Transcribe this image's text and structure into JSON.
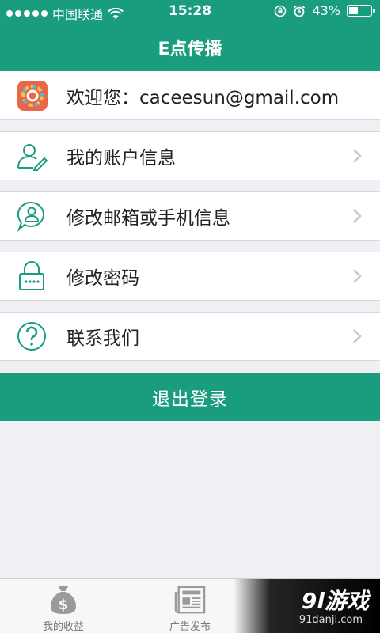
{
  "status_bar": {
    "carrier": "中国联通",
    "time": "15:28",
    "battery": "43%",
    "battery_level": 0.43
  },
  "nav": {
    "title": "E点传播"
  },
  "welcome": {
    "text": "欢迎您：caceesun@gmail.com"
  },
  "menu": {
    "items": [
      {
        "label": "我的账户信息",
        "icon": "user-edit-icon"
      },
      {
        "label": "修改邮箱或手机信息",
        "icon": "chat-user-icon"
      },
      {
        "label": "修改密码",
        "icon": "lock-icon"
      },
      {
        "label": "联系我们",
        "icon": "question-icon"
      }
    ]
  },
  "logout": {
    "label": "退出登录"
  },
  "tabs": [
    {
      "label": "我的收益",
      "icon": "money-bag-icon"
    },
    {
      "label": "广告发布",
      "icon": "newspaper-icon"
    },
    {
      "label": "",
      "icon": "people-icon"
    }
  ],
  "watermark": {
    "main": "9l游戏",
    "sub": "91danji.com"
  },
  "colors": {
    "brand": "#1a9d7f",
    "background": "#efeff4",
    "logo": "#e8674a"
  }
}
